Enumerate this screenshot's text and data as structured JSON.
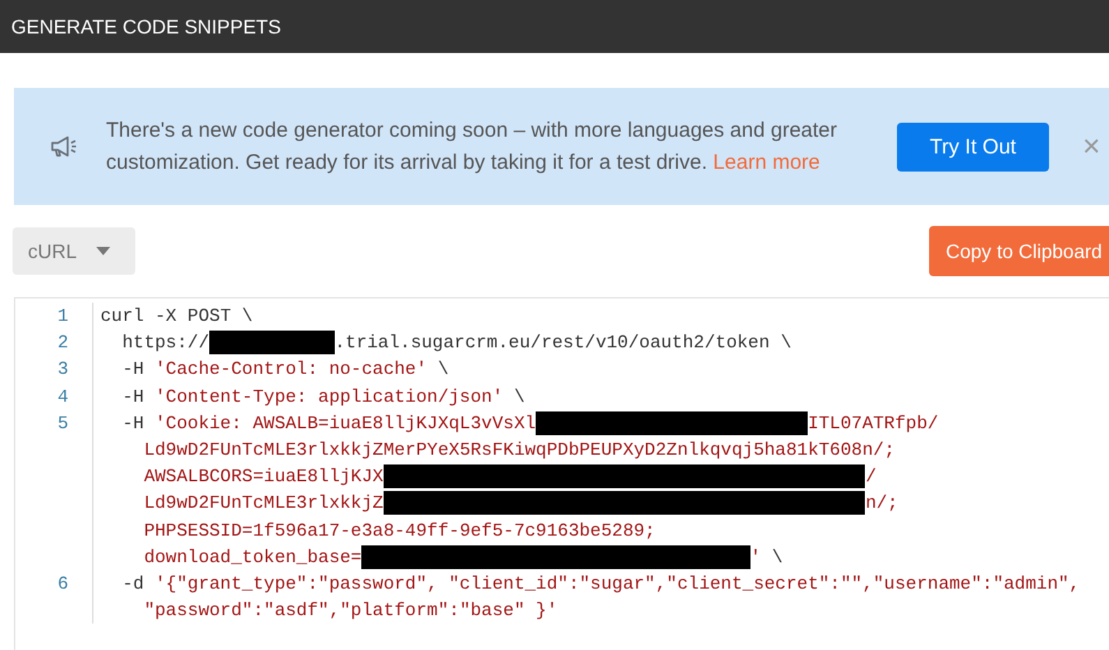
{
  "header": {
    "title": "GENERATE CODE SNIPPETS"
  },
  "banner": {
    "message": "There's a new code generator coming soon – with more languages and greater customization. Get ready for its arrival by taking it for a test drive.",
    "link": "Learn more",
    "button": "Try It Out",
    "close": "×"
  },
  "language_dropdown": {
    "value": "cURL"
  },
  "copy_button": "Copy to Clipboard",
  "code": [
    {
      "kind": "command",
      "number": "1",
      "segments": [
        {
          "kind": "plain",
          "text": "curl -X POST \\"
        }
      ]
    },
    {
      "kind": "option",
      "number": "2",
      "segments": [
        {
          "kind": "plain",
          "text": "https://"
        },
        {
          "kind": "redacted"
        },
        {
          "kind": "plain",
          "text": ".trial.sugarcrm.eu/rest/v10/oauth2/token \\"
        }
      ]
    },
    {
      "kind": "option",
      "number": "3",
      "segments": [
        {
          "kind": "plain",
          "text": "-H "
        },
        {
          "kind": "string",
          "text": "'Cache-Control: no-cache'"
        },
        {
          "kind": "plain",
          "text": " \\"
        }
      ]
    },
    {
      "kind": "option",
      "number": "4",
      "segments": [
        {
          "kind": "plain",
          "text": "-H "
        },
        {
          "kind": "string",
          "text": "'Content-Type: application/json'"
        },
        {
          "kind": "plain",
          "text": " \\"
        }
      ]
    },
    {
      "kind": "option",
      "number": "5",
      "segments": [
        {
          "kind": "plain",
          "text": "-H "
        },
        {
          "kind": "string",
          "text": "'Cookie: AWSALB=iuaE8lljKJXqL3vVsXl"
        },
        {
          "kind": "redacted"
        },
        {
          "kind": "string",
          "text": "ITL07ATRfpb/"
        }
      ]
    },
    {
      "kind": "wrapped",
      "segments": [
        {
          "kind": "string",
          "text": "Ld9wD2FUnTcMLE3rlxkkjZMerPYeX5RsFKiwqPDbPEUPXyD2Znlkqvqj5ha81kT608n/;"
        }
      ]
    },
    {
      "kind": "wrapped",
      "segments": [
        {
          "kind": "string",
          "text": "AWSALBCORS=iuaE8lljKJX"
        },
        {
          "kind": "redacted"
        },
        {
          "kind": "string",
          "text": "/"
        }
      ]
    },
    {
      "kind": "wrapped",
      "segments": [
        {
          "kind": "string",
          "text": "Ld9wD2FUnTcMLE3rlxkkjZ"
        },
        {
          "kind": "redacted"
        },
        {
          "kind": "string",
          "text": "n/;"
        }
      ]
    },
    {
      "kind": "wrapped",
      "segments": [
        {
          "kind": "string",
          "text": "PHPSESSID=1f596a17-e3a8-49ff-9ef5-7c9163be5289;"
        }
      ]
    },
    {
      "kind": "wrapped",
      "segments": [
        {
          "kind": "string",
          "text": "download_token_base="
        },
        {
          "kind": "redacted"
        },
        {
          "kind": "string",
          "text": "'"
        },
        {
          "kind": "plain",
          "text": " \\"
        }
      ]
    },
    {
      "kind": "option",
      "number": "6",
      "segments": [
        {
          "kind": "plain",
          "text": "-d "
        },
        {
          "kind": "string",
          "text": "'{\"grant_type\":\"password\", \"client_id\":\"sugar\",\"client_secret\":\"\",\"username\":\"admin\","
        }
      ]
    },
    {
      "kind": "wrapped",
      "segments": [
        {
          "kind": "string",
          "text": "\"password\":\"asdf\",\"platform\":\"base\" }'"
        }
      ]
    }
  ]
}
